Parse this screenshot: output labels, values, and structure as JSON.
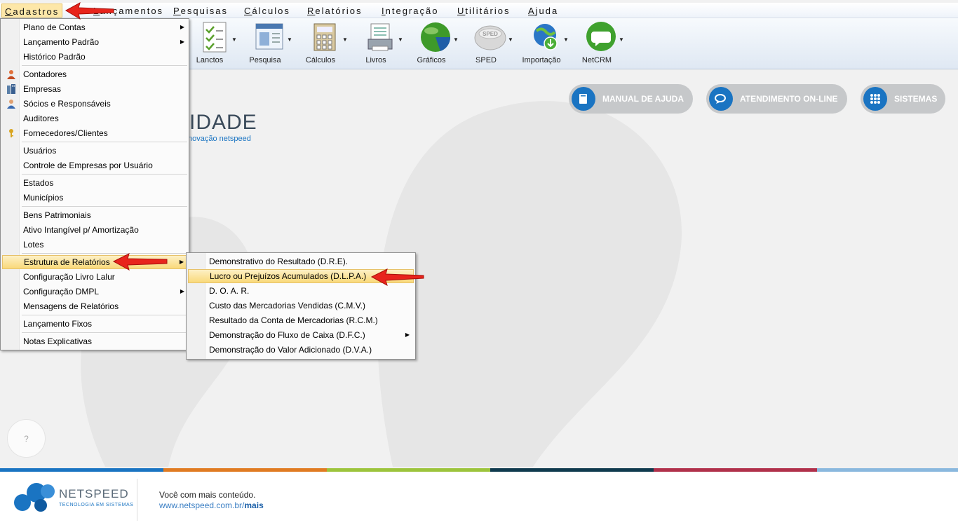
{
  "menubar": {
    "items": [
      {
        "label": "Cadastros",
        "ul": "C",
        "rest": "adastros"
      },
      {
        "label": "Lançamentos",
        "ul": "L",
        "rest": "ançamentos"
      },
      {
        "label": "Pesquisas",
        "ul": "P",
        "rest": "esquisas"
      },
      {
        "label": "Cálculos",
        "ul": "C",
        "rest": "álculos"
      },
      {
        "label": "Relatórios",
        "ul": "R",
        "rest": "elatórios"
      },
      {
        "label": "Integração",
        "ul": "I",
        "rest": "ntegração"
      },
      {
        "label": "Utilitários",
        "ul": "U",
        "rest": "tilitários"
      },
      {
        "label": "Ajuda",
        "ul": "A",
        "rest": "juda"
      }
    ]
  },
  "toolbar": {
    "buttons": [
      {
        "label": "Lanctos",
        "icon": "checklist-icon"
      },
      {
        "label": "Pesquisa",
        "icon": "search-window-icon"
      },
      {
        "label": "Cálculos",
        "icon": "calculator-icon"
      },
      {
        "label": "Livros",
        "icon": "book-printer-icon"
      },
      {
        "label": "Gráficos",
        "icon": "pie-chart-icon"
      },
      {
        "label": "SPED",
        "icon": "sped-icon"
      },
      {
        "label": "Importação",
        "icon": "globe-download-icon"
      },
      {
        "label": "NetCRM",
        "icon": "chat-bubble-icon"
      }
    ]
  },
  "content": {
    "brand_word": "IDADE",
    "brand_sub": "novação netspeed",
    "help_label": "?",
    "buttons": {
      "manual": "MANUAL DE AJUDA",
      "atendimento": "ATENDIMENTO ON-LINE",
      "sistemas": "SISTEMAS"
    }
  },
  "cadastros_menu": {
    "items": [
      {
        "label": "Plano de Contas",
        "submenu": true
      },
      {
        "label": "Lançamento Padrão",
        "submenu": true
      },
      {
        "label": "Histórico Padrão",
        "submenu": false
      },
      {
        "label": "Contadores",
        "icon": "person-icon"
      },
      {
        "label": "Empresas",
        "icon": "building-icon"
      },
      {
        "label": "Sócios e Responsáveis",
        "icon": "person-icon"
      },
      {
        "label": "Auditores"
      },
      {
        "label": "Fornecedores/Clientes",
        "icon": "key-icon"
      },
      {
        "label": "Usuários"
      },
      {
        "label": "Controle de Empresas por Usuário"
      },
      {
        "label": "Estados"
      },
      {
        "label": "Municípios"
      },
      {
        "label": "Bens Patrimoniais"
      },
      {
        "label": "Ativo Intangível p/ Amortização"
      },
      {
        "label": "Lotes"
      },
      {
        "label": "Estrutura de Relatórios",
        "submenu": true,
        "highlighted": true
      },
      {
        "label": "Configuração Livro Lalur"
      },
      {
        "label": "Configuração DMPL",
        "submenu": true
      },
      {
        "label": "Mensagens de Relatórios"
      },
      {
        "label": "Lançamento Fixos"
      },
      {
        "label": "Notas Explicativas"
      }
    ]
  },
  "estrutura_submenu": {
    "items": [
      {
        "label": "Demonstrativo do Resultado (D.R.E)."
      },
      {
        "label": "Lucro ou Prejuízos Acumulados (D.L.P.A.)",
        "highlighted": true
      },
      {
        "label": "D. O. A. R."
      },
      {
        "label": "Custo das Mercadorias Vendidas (C.M.V.)"
      },
      {
        "label": "Resultado da Conta de Mercadorias (R.C.M.)"
      },
      {
        "label": "Demonstração do Fluxo de Caixa (D.F.C.)",
        "submenu": true
      },
      {
        "label": "Demonstração do Valor Adicionado (D.V.A.)"
      }
    ]
  },
  "footer": {
    "brand": "NETSPEED",
    "tagline": "TECNOLOGIA EM SISTEMAS",
    "line1": "Você com mais conteúdo.",
    "line2_prefix": "www.netspeed.com.br/",
    "line2_bold": "mais"
  },
  "colors": {
    "accent": "#1a74c2",
    "highlight": "#f9d97a",
    "stripe": [
      "#1a74c2",
      "#e07b22",
      "#9cc43c",
      "#0f3a4e",
      "#b0304a",
      "#8ab8de"
    ]
  }
}
